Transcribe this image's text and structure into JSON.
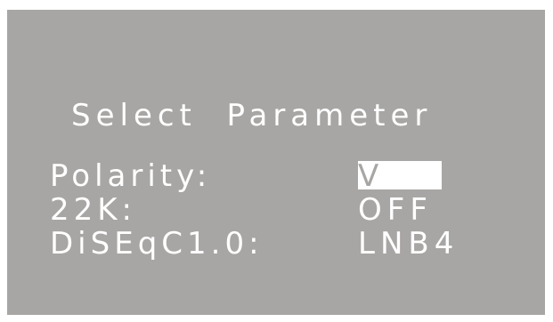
{
  "menu": {
    "title": "Select  Parameter",
    "items": [
      {
        "label": "Polarity:",
        "value": "V",
        "selected": true
      },
      {
        "label": "22K:",
        "value": "OFF",
        "selected": false
      },
      {
        "label": "DiSEqC1.0:",
        "value": "LNB4",
        "selected": false
      }
    ]
  },
  "colors": {
    "background": "#a8a6a4",
    "text": "#ffffff",
    "highlight": "#ffffff"
  }
}
